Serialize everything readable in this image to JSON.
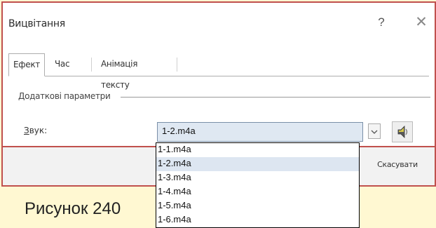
{
  "dialog": {
    "title": "Вицвітання",
    "help_label": "?",
    "close_label": "✕"
  },
  "tabs": [
    {
      "label": "Ефект",
      "active": true
    },
    {
      "label": "Час",
      "active": false
    },
    {
      "label": "Анімація тексту",
      "active": false
    }
  ],
  "group": {
    "label": "Додаткові параметри"
  },
  "sound": {
    "label": "Звук:",
    "selected_value": "1-2.m4a",
    "dropdown_arrow": "⌄",
    "options": [
      "1-1.m4a",
      "1-2.m4a",
      "1-3.m4a",
      "1-4.m4a",
      "1-5.m4a",
      "1-6.m4a"
    ],
    "selected_index": 1,
    "speaker_icon": "speaker-icon"
  },
  "footer": {
    "cancel_label": "Скасувати"
  },
  "caption": "Рисунок 240",
  "colors": {
    "frame": "#c0504d",
    "background": "#fff8d2",
    "selection": "#dde6f1"
  }
}
